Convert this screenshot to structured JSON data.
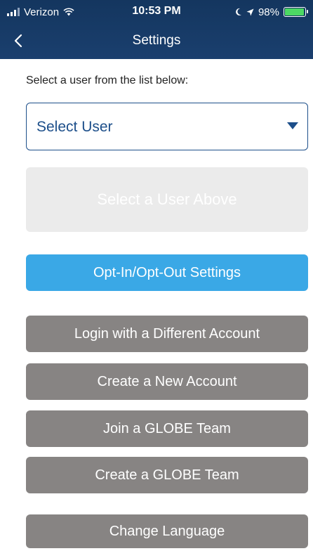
{
  "status_bar": {
    "carrier": "Verizon",
    "time": "10:53 PM",
    "battery_percent": "98%",
    "battery_level": 0.98,
    "icons": [
      "signal-icon",
      "wifi-icon",
      "location-icon",
      "battery-icon"
    ]
  },
  "nav": {
    "title": "Settings",
    "back_icon": "chevron-left-icon"
  },
  "content": {
    "instruction": "Select a user from the list below:",
    "select_user": {
      "value": "Select User",
      "icon": "caret-down-icon"
    },
    "disabled_button": "Select a User Above",
    "opt_button": "Opt-In/Opt-Out Settings",
    "buttons": [
      {
        "label": "Login with a Different Account"
      },
      {
        "label": "Create a New Account"
      },
      {
        "label": "Join a GLOBE Team"
      },
      {
        "label": "Create a GLOBE Team"
      },
      {
        "label": "Change Language"
      }
    ]
  },
  "colors": {
    "header": "#1a3f6e",
    "accent_blue": "#3aa8e6",
    "select_border": "#1d4f8a",
    "gray_button": "#878483",
    "disabled_button": "#ebebeb",
    "battery": "#4cd964"
  }
}
